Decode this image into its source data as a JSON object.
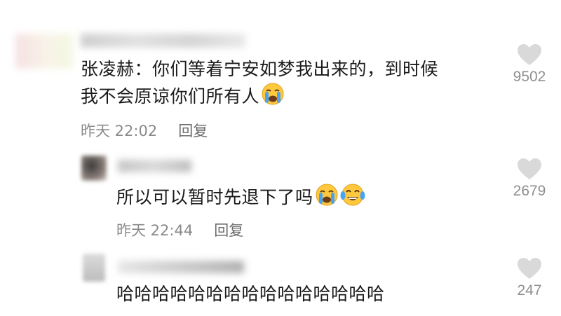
{
  "comments": [
    {
      "text_line1": "张凌赫：你们等着宁安如梦我出来的，到时候",
      "text_line2": "我不会原谅你们所有人",
      "emoji": "loudly-crying-face",
      "time": "昨天 22:02",
      "reply_label": "回复",
      "likes": "9502"
    },
    {
      "text": "所以可以暂时先退下了吗",
      "emojis": [
        "loudly-crying-face",
        "face-with-tears-of-joy"
      ],
      "time": "昨天 22:44",
      "reply_label": "回复",
      "likes": "2679"
    },
    {
      "text": "哈哈哈哈哈哈哈哈哈哈哈哈哈哈哈",
      "likes": "247"
    }
  ],
  "colors": {
    "text": "#1a1a1a",
    "meta": "#8a8a8a",
    "heart": "#d9d9d9",
    "emoji_face": "#ffc83d",
    "emoji_tear": "#4aa3f0"
  }
}
